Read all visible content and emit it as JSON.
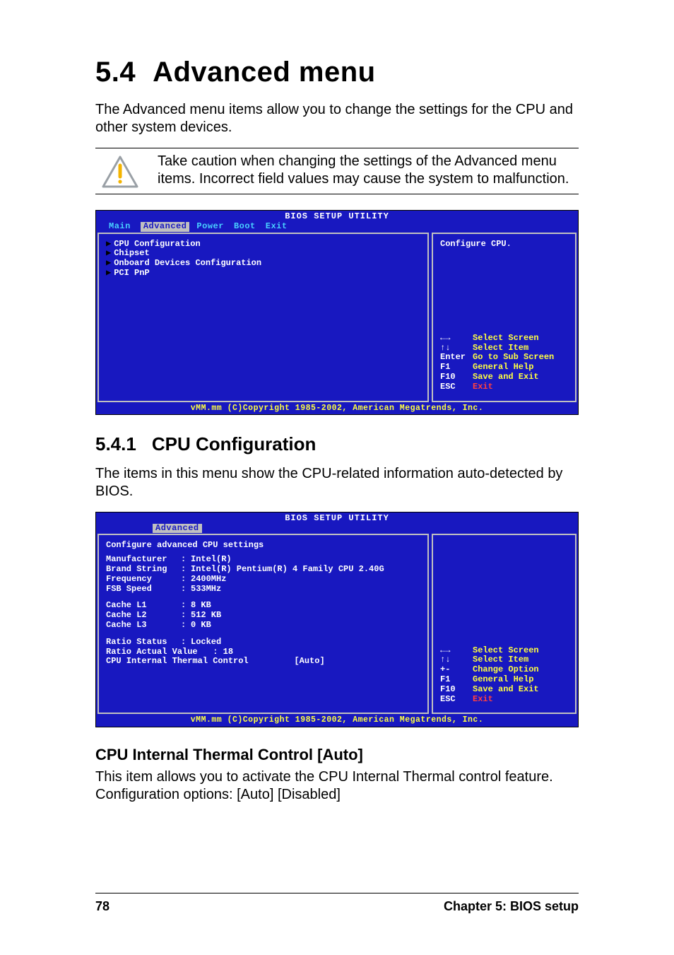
{
  "section": {
    "number": "5.4",
    "title": "Advanced menu",
    "intro": "The Advanced menu items allow you to change the settings for the CPU and other system devices.",
    "caution": "Take caution when changing the settings of the Advanced menu items. Incorrect field values may cause the system to malfunction."
  },
  "bios1": {
    "title": "BIOS SETUP UTILITY",
    "tabs": {
      "main": "Main",
      "advanced": "Advanced",
      "power": "Power",
      "boot": "Boot",
      "exit": "Exit"
    },
    "menu": {
      "i0": "CPU Configuration",
      "i1": "Chipset",
      "i2": "Onboard Devices Configuration",
      "i3": "PCI PnP"
    },
    "help": "Configure CPU.",
    "keys": {
      "r0k": "←→",
      "r0a": "Select Screen",
      "r1k": "↑↓",
      "r1a": "Select Item",
      "r2k": "Enter",
      "r2a": "Go to Sub Screen",
      "r3k": "F1",
      "r3a": "General Help",
      "r4k": "F10",
      "r4a": "Save and Exit",
      "r5k": "ESC",
      "r5a": "Exit"
    },
    "footer": "vMM.mm (C)Copyright 1985-2002, American Megatrends, Inc."
  },
  "subsection": {
    "number": "5.4.1",
    "title": "CPU Configuration",
    "intro": "The items in this menu show the CPU-related information auto-detected by BIOS."
  },
  "bios2": {
    "title": "BIOS SETUP UTILITY",
    "tab": "Advanced",
    "subtitle": "Configure advanced CPU settings",
    "rows": {
      "manufacturer_l": "Manufacturer",
      "manufacturer_v": "Intel(R)",
      "brand_l": "Brand String",
      "brand_v": "Intel(R) Pentium(R) 4 Family CPU 2.40G",
      "freq_l": "Frequency",
      "freq_v": "2400MHz",
      "fsb_l": "FSB Speed",
      "fsb_v": "533MHz",
      "l1_l": "Cache L1",
      "l1_v": "8 KB",
      "l2_l": "Cache L2",
      "l2_v": "512 KB",
      "l3_l": "Cache L3",
      "l3_v": "0 KB",
      "rstat_l": "Ratio Status",
      "rstat_v": "Locked",
      "ract": "Ratio Actual Value   : 18",
      "thermal": "CPU Internal Thermal Control         [Auto]"
    },
    "keys": {
      "r0k": "←→",
      "r0a": "Select Screen",
      "r1k": "↑↓",
      "r1a": "Select Item",
      "r2k": "+-",
      "r2a": "Change Option",
      "r3k": "F1",
      "r3a": "General Help",
      "r4k": "F10",
      "r4a": "Save and Exit",
      "r5k": "ESC",
      "r5a": "Exit"
    },
    "footer": "vMM.mm (C)Copyright 1985-2002, American Megatrends, Inc."
  },
  "field": {
    "title": "CPU Internal Thermal Control [Auto]",
    "desc": "This item allows you to activate the CPU Internal Thermal control feature. Configuration options: [Auto] [Disabled]"
  },
  "pagefoot": {
    "pagenum": "78",
    "chapter": "Chapter 5: BIOS setup"
  }
}
